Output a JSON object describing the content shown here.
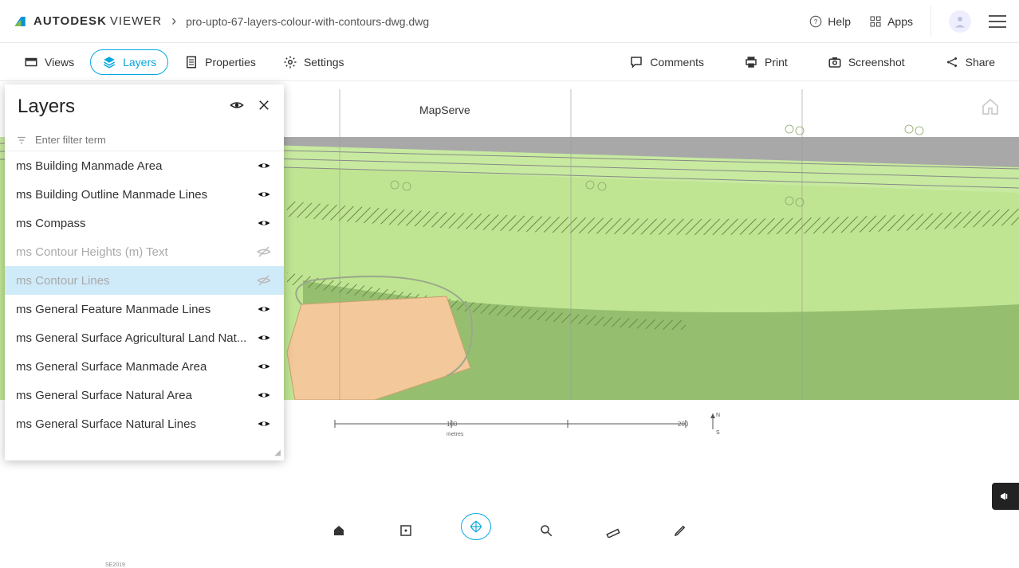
{
  "header": {
    "brand": "AUTODESK",
    "product": "VIEWER",
    "breadcrumb_sep": "›",
    "filename": "pro-upto-67-layers-colour-with-contours-dwg.dwg",
    "help": "Help",
    "apps": "Apps"
  },
  "toolbar": {
    "views": "Views",
    "layers": "Layers",
    "properties": "Properties",
    "settings": "Settings",
    "comments": "Comments",
    "print": "Print",
    "screenshot": "Screenshot",
    "share": "Share"
  },
  "panel": {
    "title": "Layers",
    "filter_placeholder": "Enter filter term",
    "items": [
      {
        "label": "ms Building Manmade Area",
        "visible": true,
        "disabled": false
      },
      {
        "label": "ms Building Outline Manmade Lines",
        "visible": true,
        "disabled": false
      },
      {
        "label": "ms Compass",
        "visible": true,
        "disabled": false
      },
      {
        "label": "ms Contour Heights (m) Text",
        "visible": false,
        "disabled": true
      },
      {
        "label": "ms Contour Lines",
        "visible": false,
        "disabled": true,
        "selected": true
      },
      {
        "label": "ms General Feature Manmade Lines",
        "visible": true,
        "disabled": false
      },
      {
        "label": "ms General Surface Agricultural Land Nat...",
        "visible": true,
        "disabled": false
      },
      {
        "label": "ms General Surface Manmade Area",
        "visible": true,
        "disabled": false
      },
      {
        "label": "ms General Surface Natural Area",
        "visible": true,
        "disabled": false
      },
      {
        "label": "ms General Surface Natural Lines",
        "visible": true,
        "disabled": false
      }
    ]
  },
  "canvas": {
    "map_label": "MapServe",
    "scale_mid": "100",
    "scale_end": "200",
    "scale_unit": "metres",
    "compass_n": "N",
    "compass_s": "S",
    "footer_tag": "SE2019"
  }
}
